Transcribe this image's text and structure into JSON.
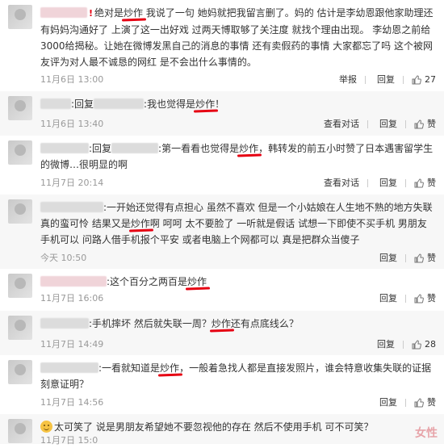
{
  "comments": [
    {
      "text_a": "绝对是",
      "hl": "炒作",
      "text_b": "我说了一句 她妈就把我留言删了。妈的 估计是李幼恩跟他家助理还有妈妈沟通好了 上演了这一出好戏 过两天博取够了关注度 就找个理由出现。 李幼恩之前给3000给揭秘。让她在微博发黑自己的消息的事情 还有卖假药的事情 大家都忘了吗 这个被网友评为对人最不诚恳的网红 是不会出什么事情的。",
      "time": "11月6日 13:00",
      "report": "举报",
      "reply": "回复",
      "likes": "27"
    },
    {
      "prefix": ":回复",
      "text_a": ":我也觉得是",
      "hl": "炒作",
      "text_b": "！",
      "time": "11月6日 13:40",
      "view_conversation": "查看对话",
      "reply": "回复",
      "likes": "赞"
    },
    {
      "prefix": ":回复",
      "text_a": ":第一看看也觉得是",
      "hl": "炒作",
      "text_b": "，韩转发的前五小时赞了日本遇害留学生的微博…很明显的啊",
      "time": "11月7日 20:14",
      "view_conversation": "查看对话",
      "reply": "回复",
      "likes": "赞"
    },
    {
      "text_a": ":一开始还觉得有点担心 虽然不喜欢 但是一个小姑娘在人生地不熟的地方失联真的蛮可怜 结果又是",
      "hl": "炒作",
      "text_b": "啊 呵呵 太不要脸了 一听就是假话 试想一下即使不买手机 男朋友手机可以 问路人借手机报个平安 或者电脑上个网都可以 真是把群众当傻子",
      "time": "今天 10:50",
      "reply": "回复",
      "likes": "赞"
    },
    {
      "text_a": ":这个百分之两百是",
      "hl": "炒作",
      "text_b": "",
      "time": "11月7日 16:06",
      "reply": "回复",
      "likes": "赞"
    },
    {
      "text_a": ":手机摔坏 然后就失联一周？",
      "hl": "炒作",
      "text_b": "还有点底线么？",
      "time": "11月7日 14:49",
      "reply": "回复",
      "likes": "28"
    },
    {
      "text_a": ":一看就知道是",
      "hl": "炒作",
      "text_b": "，一般着急找人都是直接发照片，谁会特意收集失联的证据刻意证明？",
      "time": "11月7日 14:56",
      "reply": "回复",
      "likes": "赞"
    },
    {
      "text_a": "太可笑了 说是男朋友希望她不要忽视他的存在 然后不使用手机 可不可笑？",
      "time": "11月7日 15:0"
    }
  ],
  "watermark": "女性",
  "colors": {
    "accent": "#e60012",
    "meta": "#999999"
  }
}
